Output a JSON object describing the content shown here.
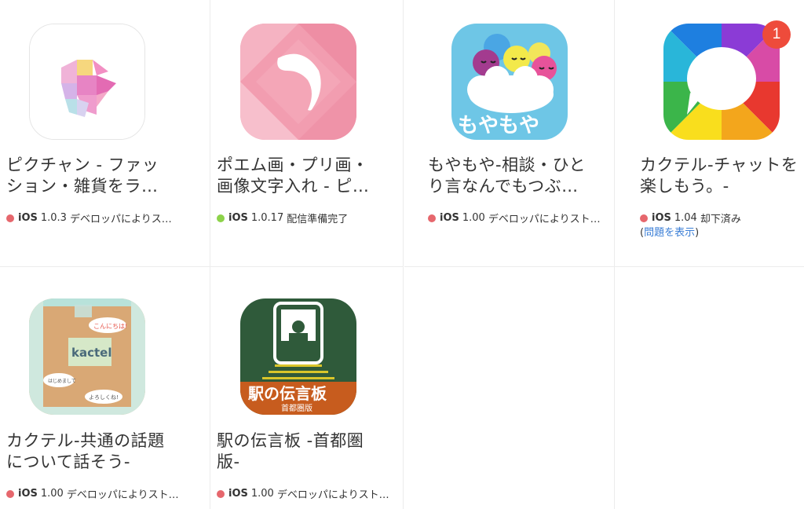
{
  "apps": [
    {
      "name_line1": "ピクチャン - ファッ",
      "name_line2": "ション・雑貨をラ…",
      "platform": "iOS",
      "version": "1.0.3",
      "status": "デベロッパによりス…",
      "status_color": "#e6676d",
      "icon": "heart-mosaic-icon"
    },
    {
      "name_line1": "ポエム画・プリ画・",
      "name_line2": "画像文字入れ - ピ…",
      "platform": "iOS",
      "version": "1.0.17",
      "status": "配信準備完了",
      "status_color": "#8dd34a",
      "icon": "feather-icon"
    },
    {
      "name_line1": "もやもや-相談・ひと",
      "name_line2": "り言なんでもつぶ…",
      "platform": "iOS",
      "version": "1.00",
      "status": "デベロッパによりスト…",
      "status_color": "#e6676d",
      "icon": "moyamoya-cloud-icon",
      "icon_text": "もやもや"
    },
    {
      "name_line1": "カクテル-チャットを",
      "name_line2": "楽しもう。-",
      "platform": "iOS",
      "version": "1.04",
      "status": "却下済み",
      "status_color": "#e6676d",
      "icon": "chat-bubble-icon",
      "badge": "1",
      "link_prefix": "(",
      "link_text": "問題を表示",
      "link_suffix": ")"
    },
    {
      "name_line1": "カクテル-共通の話題",
      "name_line2": "について話そう-",
      "platform": "iOS",
      "version": "1.00",
      "status": "デベロッパによりスト…",
      "status_color": "#e6676d",
      "icon": "kactel-board-icon",
      "icon_text": "kactel",
      "bubble1": "こんにちは!",
      "bubble2": "はじめまして",
      "bubble3": "よろしくね!"
    },
    {
      "name_line1": "駅の伝言板 -首都圏",
      "name_line2": "版-",
      "platform": "iOS",
      "version": "1.00",
      "status": "デベロッパによりスト…",
      "status_color": "#e6676d",
      "icon": "train-board-icon",
      "icon_text": "駅の伝言板",
      "icon_subtext": "首都圏版"
    }
  ]
}
